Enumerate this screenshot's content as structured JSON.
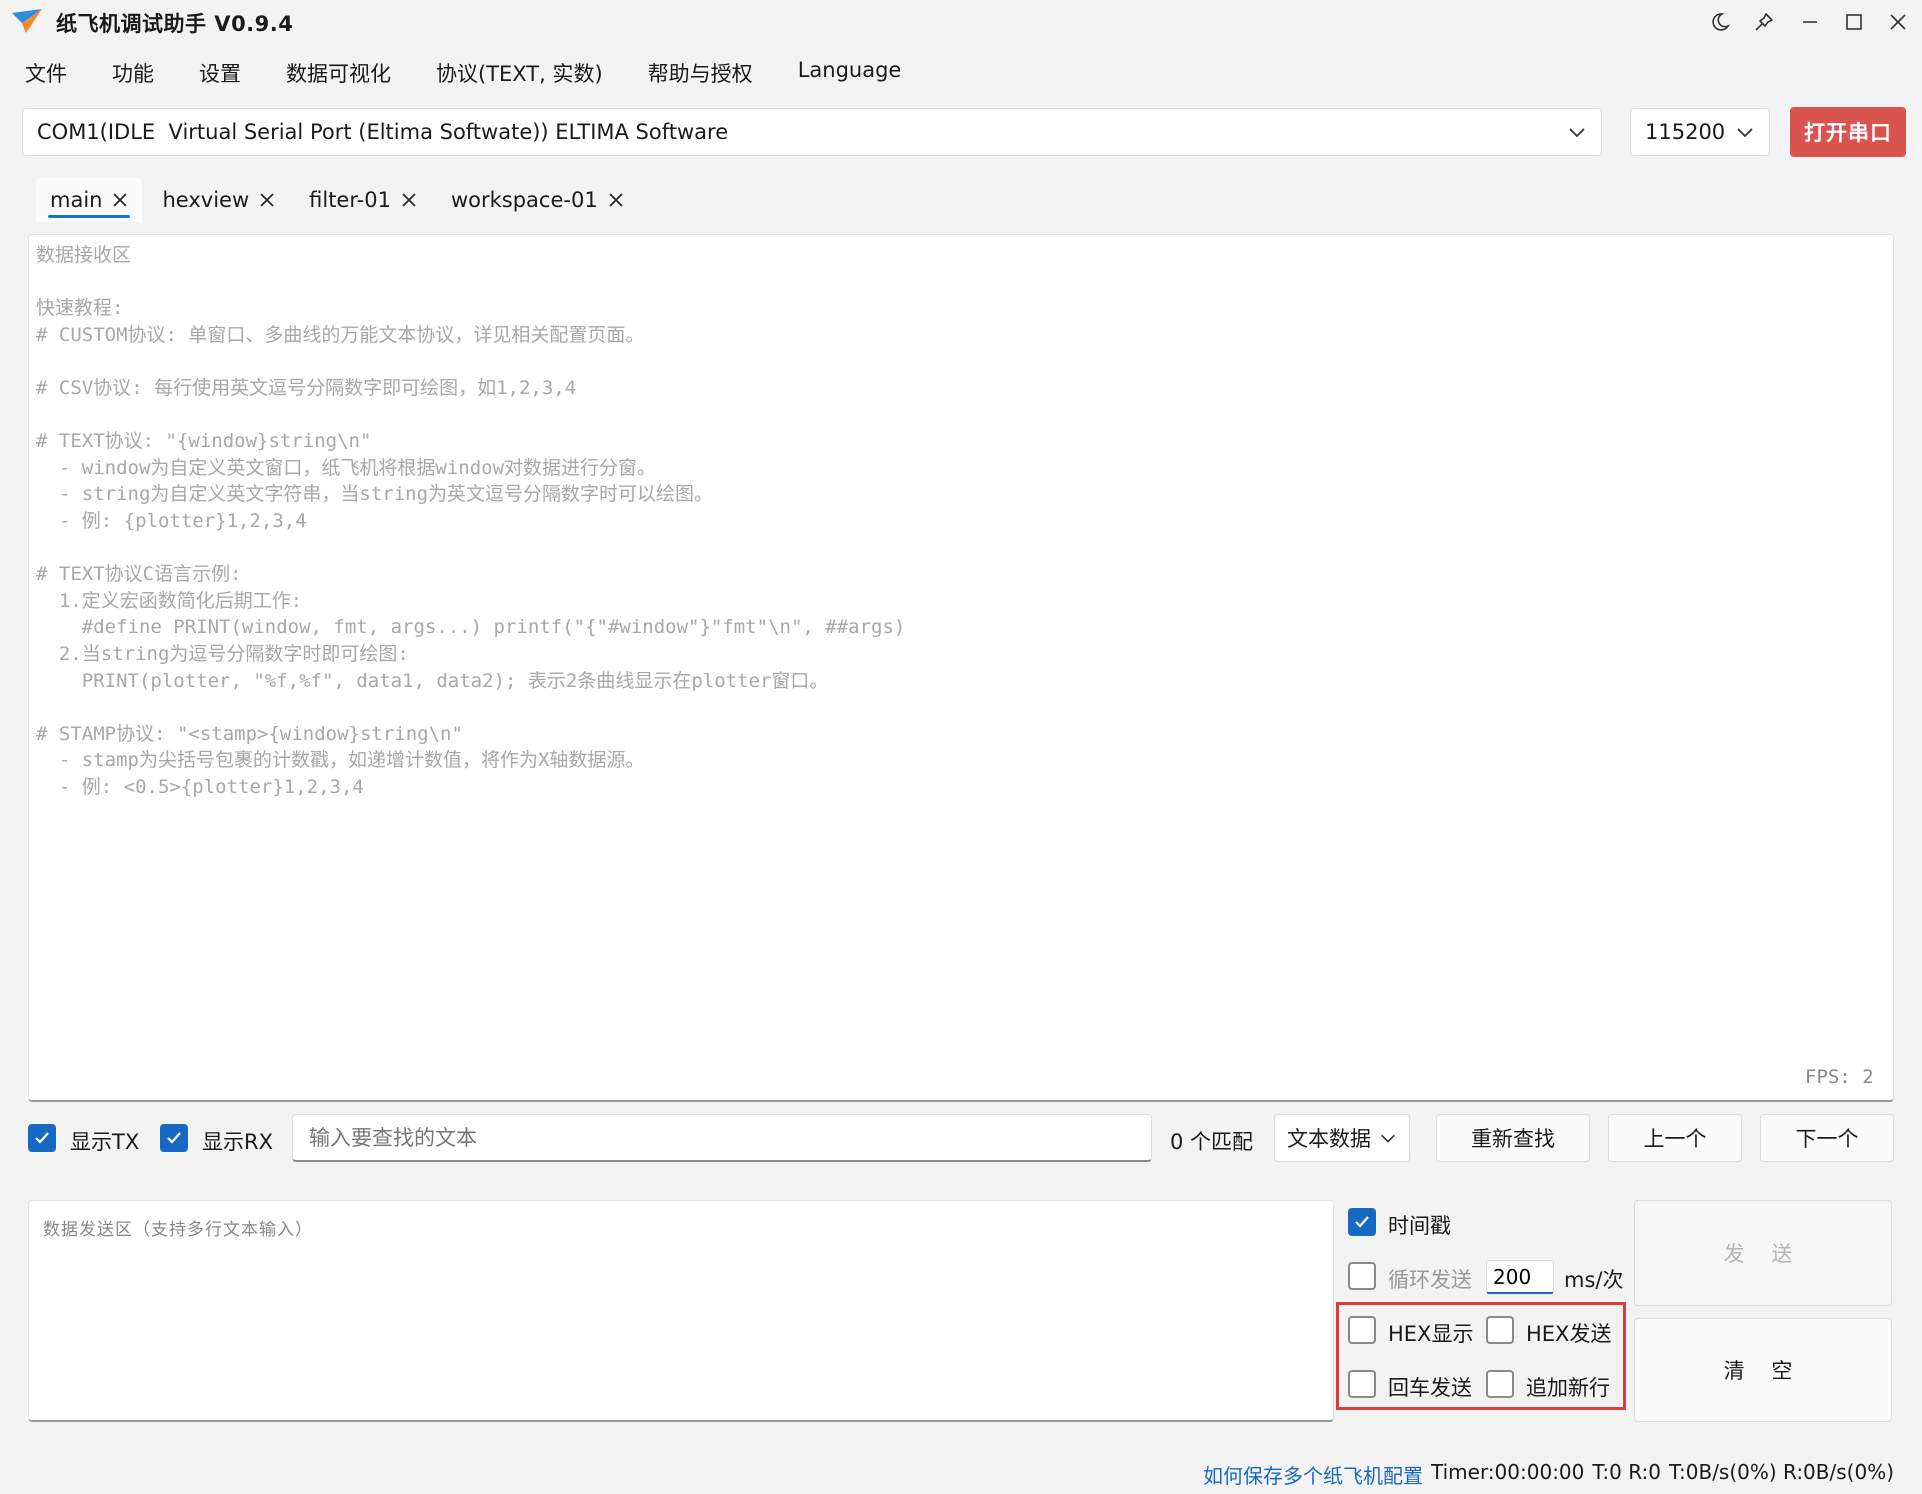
{
  "window": {
    "title": "纸飞机调试助手 V0.9.4",
    "controls": [
      "moon-icon",
      "pin-icon",
      "minimize-icon",
      "maximize-icon",
      "close-icon"
    ]
  },
  "menu": {
    "items": [
      {
        "label": "文件"
      },
      {
        "label": "功能"
      },
      {
        "label": "设置"
      },
      {
        "label": "数据可视化"
      },
      {
        "label": "协议(TEXT, 实数)"
      },
      {
        "label": "帮助与授权"
      },
      {
        "label": "Language"
      }
    ]
  },
  "port": {
    "selected": "COM1(IDLE  Virtual Serial Port (Eltima Softwate)) ELTIMA Software",
    "baud": "115200",
    "open_label": "打开串口"
  },
  "tabs": [
    {
      "label": "main",
      "active": true
    },
    {
      "label": "hexview",
      "active": false
    },
    {
      "label": "filter-01",
      "active": false
    },
    {
      "label": "workspace-01",
      "active": false
    }
  ],
  "receive": {
    "placeholder_lines": "数据接收区\n\n快速教程:\n# CUSTOM协议: 单窗口、多曲线的万能文本协议，详见相关配置页面。\n\n# CSV协议: 每行使用英文逗号分隔数字即可绘图，如1,2,3,4\n\n# TEXT协议: \"{window}string\\n\"\n  - window为自定义英文窗口，纸飞机将根据window对数据进行分窗。\n  - string为自定义英文字符串，当string为英文逗号分隔数字时可以绘图。\n  - 例: {plotter}1,2,3,4\n\n# TEXT协议C语言示例:\n  1.定义宏函数简化后期工作:\n    #define PRINT(window, fmt, args...) printf(\"{\"#window\"}\"fmt\"\\n\", ##args)\n  2.当string为逗号分隔数字时即可绘图:\n    PRINT(plotter, \"%f,%f\", data1, data2); 表示2条曲线显示在plotter窗口。\n\n# STAMP协议: \"<stamp>{window}string\\n\"\n  - stamp为尖括号包裹的计数戳，如递增计数值，将作为X轴数据源。\n  - 例: <0.5>{plotter}1,2,3,4",
    "fps": "FPS: 2"
  },
  "search": {
    "show_tx_label": "显示TX",
    "show_tx": true,
    "show_rx_label": "显示RX",
    "show_rx": true,
    "placeholder": "输入要查找的文本",
    "match_count": "0 个匹配",
    "mode": "文本数据",
    "refind_label": "重新查找",
    "prev_label": "上一个",
    "next_label": "下一个"
  },
  "send": {
    "placeholder": "数据发送区（支持多行文本输入）",
    "timestamp_label": "时间戳",
    "timestamp": true,
    "loop_label": "循环发送",
    "loop": false,
    "interval": "200",
    "interval_unit": "ms/次",
    "hex_display_label": "HEX显示",
    "hex_send_label": "HEX发送",
    "cr_send_label": "回车发送",
    "append_newline_label": "追加新行",
    "send_label": "发 送",
    "clear_label": "清 空"
  },
  "status": {
    "help_link": "如何保存多个纸飞机配置",
    "timer": "Timer:00:00:00",
    "counts": "T:0 R:0",
    "rates": "T:0B/s(0%) R:0B/s(0%)"
  },
  "colors": {
    "accent": "#1769c4",
    "open_button": "#d9534f",
    "highlight_box": "#e03b3b"
  }
}
